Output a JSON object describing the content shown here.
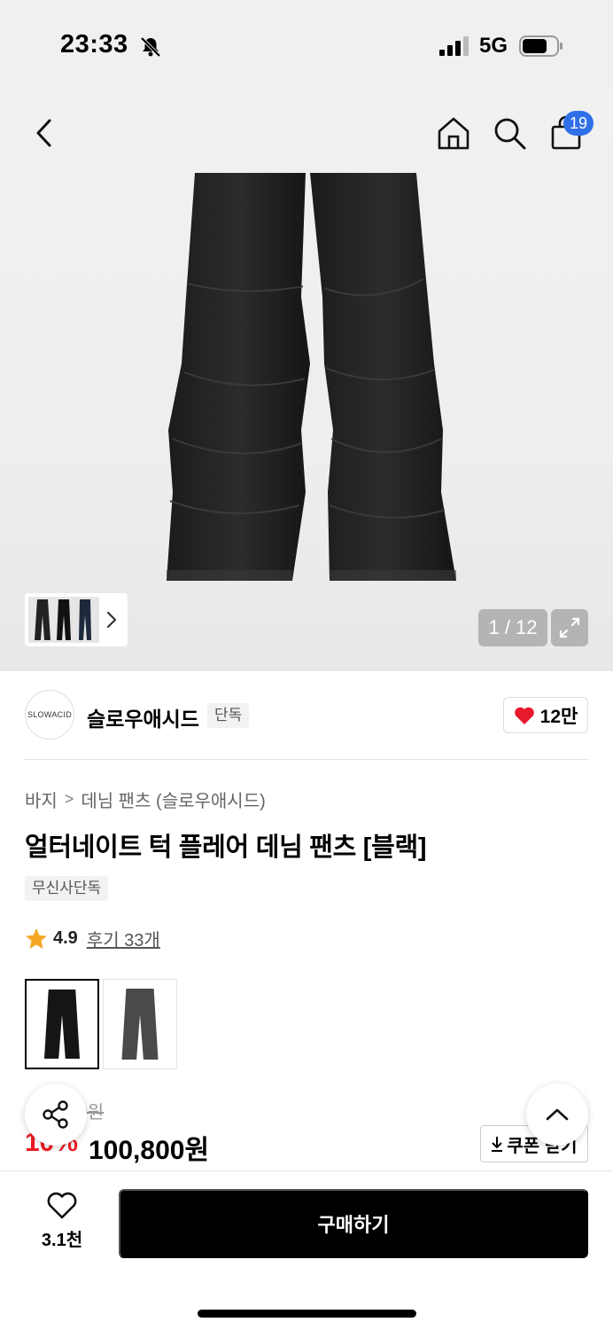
{
  "status_bar": {
    "time": "23:33",
    "network": "5G"
  },
  "nav": {
    "cart_count": "19"
  },
  "gallery": {
    "counter": "1 / 12"
  },
  "brand": {
    "logo_text": "SLOWACID",
    "name": "슬로우애시드",
    "tag": "단독",
    "likes": "12만"
  },
  "breadcrumb": {
    "level1": "바지",
    "separator": ">",
    "level2": "데님 팬츠 (슬로우애시드)"
  },
  "product": {
    "title": "얼터네이트 턱 플레어 데님 팬츠 [블랙]",
    "exclusive_label": "무신사단독",
    "rating": "4.9",
    "reviews": "후기 33개"
  },
  "price": {
    "original": "112,000원",
    "discount": "10%",
    "sale": "100,800원",
    "coupon_button": "쿠폰 받기"
  },
  "bottom": {
    "wish_count": "3.1천",
    "buy_label": "구매하기"
  },
  "colors": {
    "accent_blue": "#2f6fe8",
    "discount_red": "#ee1c25",
    "heart_red": "#e8192c",
    "star_orange": "#f5a623"
  }
}
